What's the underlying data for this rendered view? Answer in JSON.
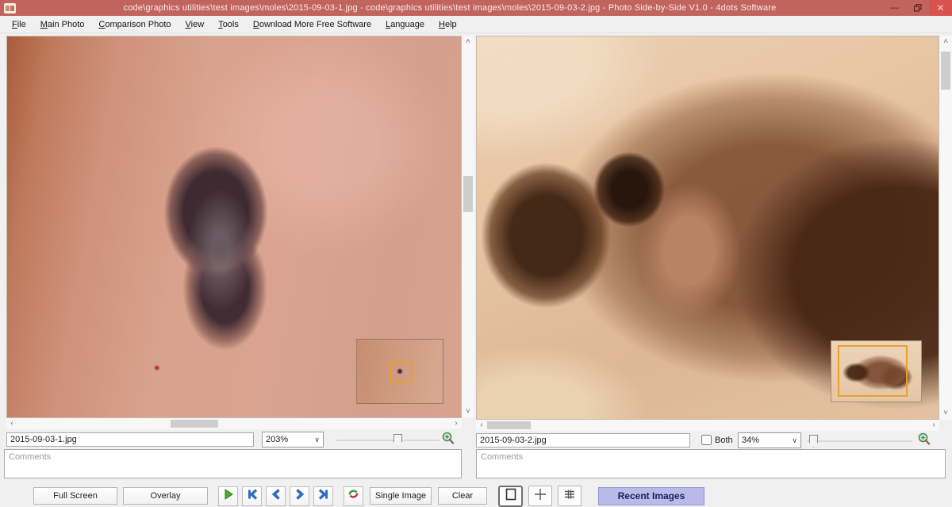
{
  "window": {
    "title": "code\\graphics utilities\\test images\\moles\\2015-09-03-1.jpg - code\\graphics utilities\\test images\\moles\\2015-09-03-2.jpg - Photo Side-by-Side V1.0 - 4dots Software",
    "minimize_glyph": "—",
    "close_glyph": "✕"
  },
  "menu": {
    "items": [
      {
        "label": "File",
        "mnemonic": "F"
      },
      {
        "label": "Main Photo",
        "mnemonic": "M"
      },
      {
        "label": "Comparison Photo",
        "mnemonic": "C"
      },
      {
        "label": "View",
        "mnemonic": "V"
      },
      {
        "label": "Tools",
        "mnemonic": "T"
      },
      {
        "label": "Download More Free Software",
        "mnemonic": "D"
      },
      {
        "label": "Language",
        "mnemonic": "L"
      },
      {
        "label": "Help",
        "mnemonic": "H"
      }
    ]
  },
  "left_panel": {
    "filename": "2015-09-03-1.jpg",
    "zoom": "203%",
    "comments_placeholder": "Comments"
  },
  "right_panel": {
    "filename": "2015-09-03-2.jpg",
    "zoom": "34%",
    "both_label": "Both",
    "comments_placeholder": "Comments"
  },
  "toolbar": {
    "full_screen": "Full Screen",
    "overlay": "Overlay",
    "single_image": "Single Image",
    "clear": "Clear",
    "recent_images": "Recent Images"
  },
  "icons": {
    "scroll_left": "‹",
    "scroll_right": "›",
    "scroll_up": "˄",
    "scroll_down": "˅",
    "combo_chevron": "∨"
  },
  "colors": {
    "titlebar": "#c2645e",
    "close_button": "#d9534e",
    "navigator_rect": "#e79f2e",
    "nav_arrow_blue": "#2e6ec0",
    "play_green": "#44ad2b",
    "recent_button_bg": "#b9b9ea"
  }
}
